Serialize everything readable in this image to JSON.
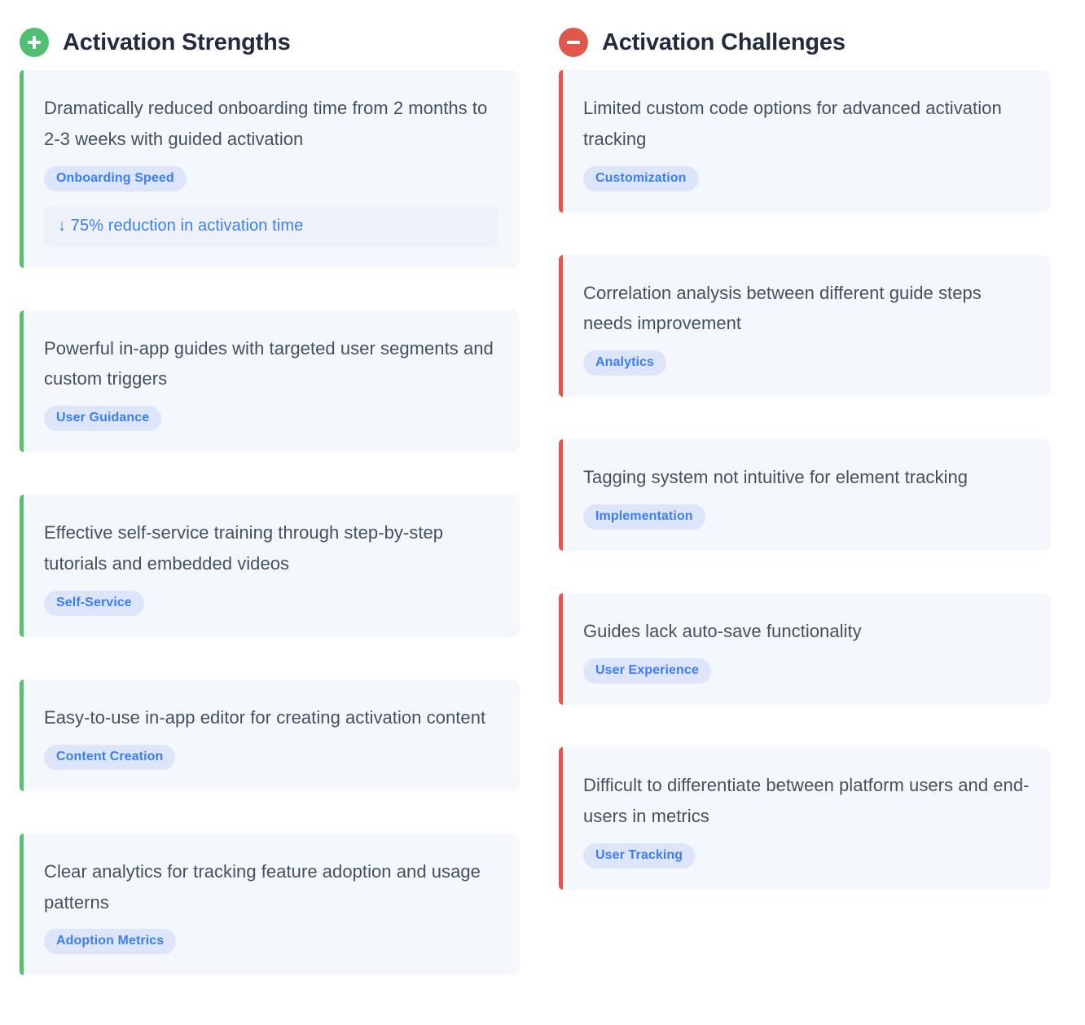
{
  "columns": [
    {
      "id": "strengths",
      "title": "Activation Strengths",
      "icon": "plus-circle-icon",
      "icon_color": "#4fc072",
      "accent_color": "#57c16d",
      "cards": [
        {
          "text": "Dramatically reduced onboarding time from 2 months to 2-3 weeks with guided activation",
          "tag": "Onboarding Speed",
          "metric": "↓ 75% reduction in activation time"
        },
        {
          "text": "Powerful in-app guides with targeted user segments and custom triggers",
          "tag": "User Guidance"
        },
        {
          "text": "Effective self-service training through step-by-step tutorials and embedded videos",
          "tag": "Self-Service"
        },
        {
          "text": "Easy-to-use in-app editor for creating activation content",
          "tag": "Content Creation"
        },
        {
          "text": "Clear analytics for tracking feature adoption and usage patterns",
          "tag": "Adoption Metrics"
        }
      ]
    },
    {
      "id": "challenges",
      "title": "Activation Challenges",
      "icon": "minus-circle-icon",
      "icon_color": "#e2574c",
      "accent_color": "#e8534a",
      "cards": [
        {
          "text": "Limited custom code options for advanced activation tracking",
          "tag": "Customization"
        },
        {
          "text": "Correlation analysis between different guide steps needs improvement",
          "tag": "Analytics"
        },
        {
          "text": "Tagging system not intuitive for element tracking",
          "tag": "Implementation"
        },
        {
          "text": "Guides lack auto-save functionality",
          "tag": "User Experience"
        },
        {
          "text": "Difficult to differentiate between platform users and end-users in metrics",
          "tag": "User Tracking"
        }
      ]
    }
  ],
  "theme": {
    "card_background": "#f4f7fb",
    "tag_background": "#dde5fb",
    "tag_text": "#3b7ef5",
    "body_text": "#45505f",
    "title_text": "#232b3e",
    "metric_background": "#eef2f8"
  }
}
